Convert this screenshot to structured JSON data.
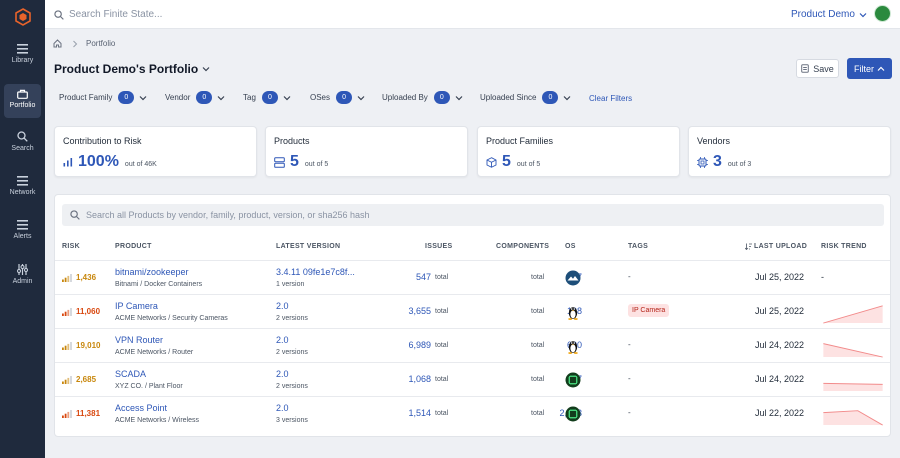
{
  "sidebar": {
    "items": [
      {
        "label": "Library",
        "icon": "library-icon"
      },
      {
        "label": "Portfolio",
        "icon": "briefcase-icon"
      },
      {
        "label": "Search",
        "icon": "search-icon"
      },
      {
        "label": "Network",
        "icon": "network-icon"
      },
      {
        "label": "Alerts",
        "icon": "alerts-icon"
      },
      {
        "label": "Admin",
        "icon": "admin-icon"
      }
    ]
  },
  "topbar": {
    "search_placeholder": "Search Finite State...",
    "org_name": "Product Demo"
  },
  "breadcrumb": {
    "current": "Portfolio"
  },
  "page": {
    "title": "Product Demo's Portfolio",
    "save_label": "Save",
    "filter_label": "Filter"
  },
  "filters": [
    {
      "label": "Product Family",
      "count": "0"
    },
    {
      "label": "Vendor",
      "count": "0"
    },
    {
      "label": "Tag",
      "count": "0"
    },
    {
      "label": "OSes",
      "count": "0"
    },
    {
      "label": "Uploaded By",
      "count": "0"
    },
    {
      "label": "Uploaded Since",
      "count": "0"
    }
  ],
  "clear_filters": "Clear Filters",
  "summary": [
    {
      "title": "Contribution to Risk",
      "value": "100%",
      "sub": "out of 46K"
    },
    {
      "title": "Products",
      "value": "5",
      "sub": "out of 5"
    },
    {
      "title": "Product Families",
      "value": "5",
      "sub": "out of 5"
    },
    {
      "title": "Vendors",
      "value": "3",
      "sub": "out of 3"
    }
  ],
  "table": {
    "search_placeholder": "Search all Products by vendor, family, product, version, or sha256 hash",
    "headers": {
      "risk": "RISK",
      "product": "PRODUCT",
      "latest_version": "LATEST VERSION",
      "issues": "ISSUES",
      "components": "COMPONENTS",
      "os": "OS",
      "tags": "TAGS",
      "last_upload": "LAST UPLOAD",
      "risk_trend": "RISK TREND"
    },
    "total_label": "total",
    "rows": [
      {
        "risk": "1,436",
        "risk_color": "#c8870c",
        "name": "bitnami/zookeeper",
        "sub": "Bitnami / Docker Containers",
        "version": "3.4.11 09fe1e7c8f...",
        "versions": "1 version",
        "issues": "547",
        "components": "147",
        "os": "alpine-icon",
        "tag": "-",
        "upload": "Jul 25, 2022",
        "trend": "-"
      },
      {
        "risk": "11,060",
        "risk_color": "#d9480f",
        "name": "IP Camera",
        "sub": "ACME Networks / Security Cameras",
        "version": "2.0",
        "versions": "2 versions",
        "issues": "3,655",
        "components": "108",
        "os": "linux-icon",
        "tag": "IP Camera",
        "upload": "Jul 25, 2022",
        "trend": "up"
      },
      {
        "risk": "19,010",
        "risk_color": "#c8870c",
        "name": "VPN Router",
        "sub": "ACME Networks / Router",
        "version": "2.0",
        "versions": "2 versions",
        "issues": "6,989",
        "components": "600",
        "os": "linux-icon",
        "tag": "-",
        "upload": "Jul 24, 2022",
        "trend": "down"
      },
      {
        "risk": "2,685",
        "risk_color": "#c8870c",
        "name": "SCADA",
        "sub": "XYZ CO. / Plant Floor",
        "version": "2.0",
        "versions": "2 versions",
        "issues": "1,068",
        "components": "467",
        "os": "chip-icon",
        "tag": "-",
        "upload": "Jul 24, 2022",
        "trend": "flat"
      },
      {
        "risk": "11,381",
        "risk_color": "#d9480f",
        "name": "Access Point",
        "sub": "ACME Networks / Wireless",
        "version": "2.0",
        "versions": "3 versions",
        "issues": "1,514",
        "components": "2,683",
        "os": "chip-icon",
        "tag": "-",
        "upload": "Jul 22, 2022",
        "trend": "peak"
      }
    ]
  }
}
